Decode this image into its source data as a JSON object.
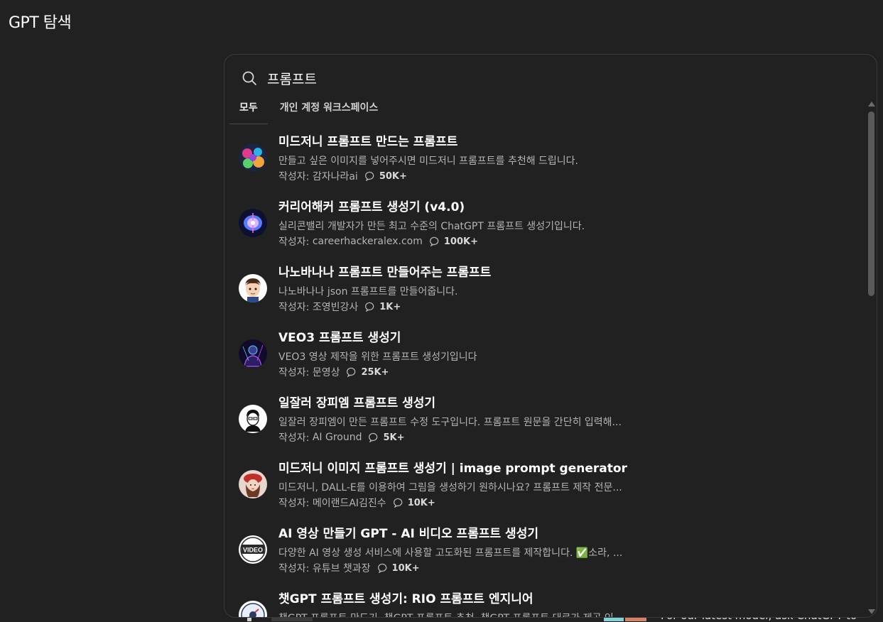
{
  "page": {
    "title": "GPT 탐색"
  },
  "search": {
    "value": "프롬프트",
    "icon": "search-icon"
  },
  "tabs": [
    {
      "label": "모두",
      "active": true
    },
    {
      "label": "개인 계정 워크스페이스",
      "active": false
    }
  ],
  "author_prefix": "작성자:",
  "results": [
    {
      "title": "미드저니 프롬프트 만드는 프롬프트",
      "description": "만들고 싶은 이미지를 넣어주시면 미드저니 프롬프트를 추천해 드립니다.",
      "author": "감자나라ai",
      "count": "50K+",
      "avatar": "colorful-art-avatar"
    },
    {
      "title": "커리어해커 프롬프트 생성기 (v4.0)",
      "description": "실리콘밸리 개발자가 만든 최고 수준의 ChatGPT 프롬프트 생성기입니다.",
      "author": "careerhackeralex.com",
      "count": "100K+",
      "avatar": "neon-brain-avatar"
    },
    {
      "title": "나노바나나 프롬프트 만들어주는 프롬프트",
      "description": "나노바나나 json 프롬프트를 만들어줍니다.",
      "author": "조영빈강사",
      "count": "1K+",
      "avatar": "cartoon-person-avatar"
    },
    {
      "title": "VEO3 프롬프트 생성기",
      "description": "VEO3 영상 제작을 위한 프롬프트 생성기입니다",
      "author": "문영상",
      "count": "25K+",
      "avatar": "neon-figure-avatar"
    },
    {
      "title": "일잘러 장피엠 프롬프트 생성기",
      "description": "일잘러 장피엠이 만든 프롬프트 수정 도구입니다. 프롬프트 원문을 간단히 입력해...",
      "author": "AI Ground",
      "count": "5K+",
      "avatar": "sketch-person-avatar"
    },
    {
      "title": "미드저니 이미지 프롬프트 생성기 | image prompt generator",
      "description": "미드저니, DALL-E를 이용하여 그림을 생성하기 원하시나요? 프롬프트 제작 전문...",
      "author": "메이랜드AI김진수",
      "count": "10K+",
      "avatar": "woman-red-hat-avatar"
    },
    {
      "title": "AI 영상 만들기 GPT - AI 비디오 프롬프트 생성기",
      "description": "다양한 AI 영상 생성 서비스에 사용할 고도화된 프롬프트를 제작합니다. ✅소라, ...",
      "author": "유튜브 챗과장",
      "count": "10K+",
      "avatar": "video-logo-avatar"
    },
    {
      "title": "챗GPT 프롬프트 생성기: RIO 프롬프트 엔지니어",
      "description": "챗GPT 프롬프트 만드기, 챗GPT 프롬프트 추천, 챗GPT 프롬프트 대로가 제공 인...",
      "author": "",
      "count": "",
      "avatar": "rio-logo-avatar"
    }
  ],
  "background": {
    "peek_text": "For our latest model, ask ChatGPT to"
  },
  "colors": {
    "background": "#212121",
    "border": "#3a3a3a",
    "text_primary": "#ffffff",
    "text_secondary": "#b4b4b4"
  }
}
